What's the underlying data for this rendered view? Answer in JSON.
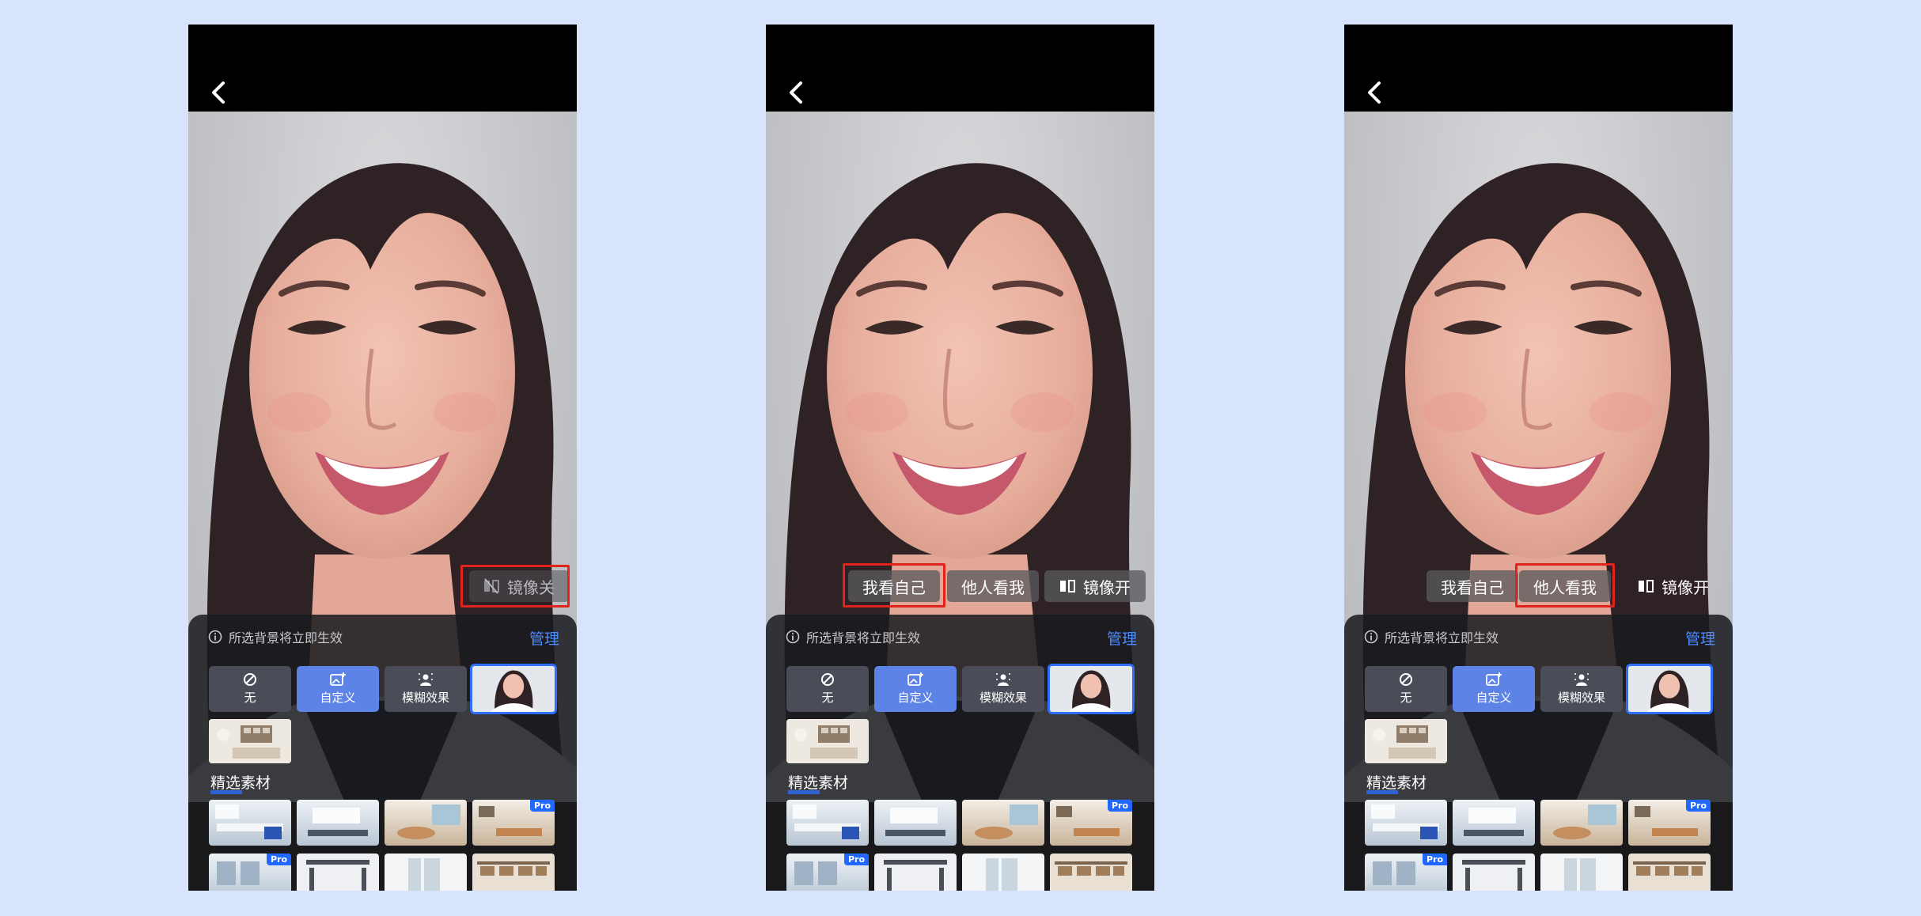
{
  "colors": {
    "page_bg": "#d8e4fc",
    "accent_blue": "#2f6fff",
    "highlight_red": "#e0241c"
  },
  "screens": [
    {
      "mode": "mirror-off",
      "mirror_label": "镜像关",
      "info_text": "所选背景将立即生效",
      "manage_label": "管理",
      "options": {
        "none": "无",
        "custom": "自定义",
        "blur": "模糊效果"
      },
      "section_title": "精选素材",
      "pro_badge": "Pro"
    },
    {
      "mode": "mirror-on",
      "self_view_label": "我看自己",
      "others_view_label": "他人看我",
      "mirror_label": "镜像开",
      "info_text": "所选背景将立即生效",
      "manage_label": "管理",
      "options": {
        "none": "无",
        "custom": "自定义",
        "blur": "模糊效果"
      },
      "section_title": "精选素材",
      "pro_badge": "Pro"
    },
    {
      "mode": "mirror-on-others",
      "self_view_label": "我看自己",
      "others_view_label": "他人看我",
      "mirror_label": "镜像开",
      "info_text": "所选背景将立即生效",
      "manage_label": "管理",
      "options": {
        "none": "无",
        "custom": "自定义",
        "blur": "模糊效果"
      },
      "section_title": "精选素材",
      "pro_badge": "Pro"
    }
  ]
}
